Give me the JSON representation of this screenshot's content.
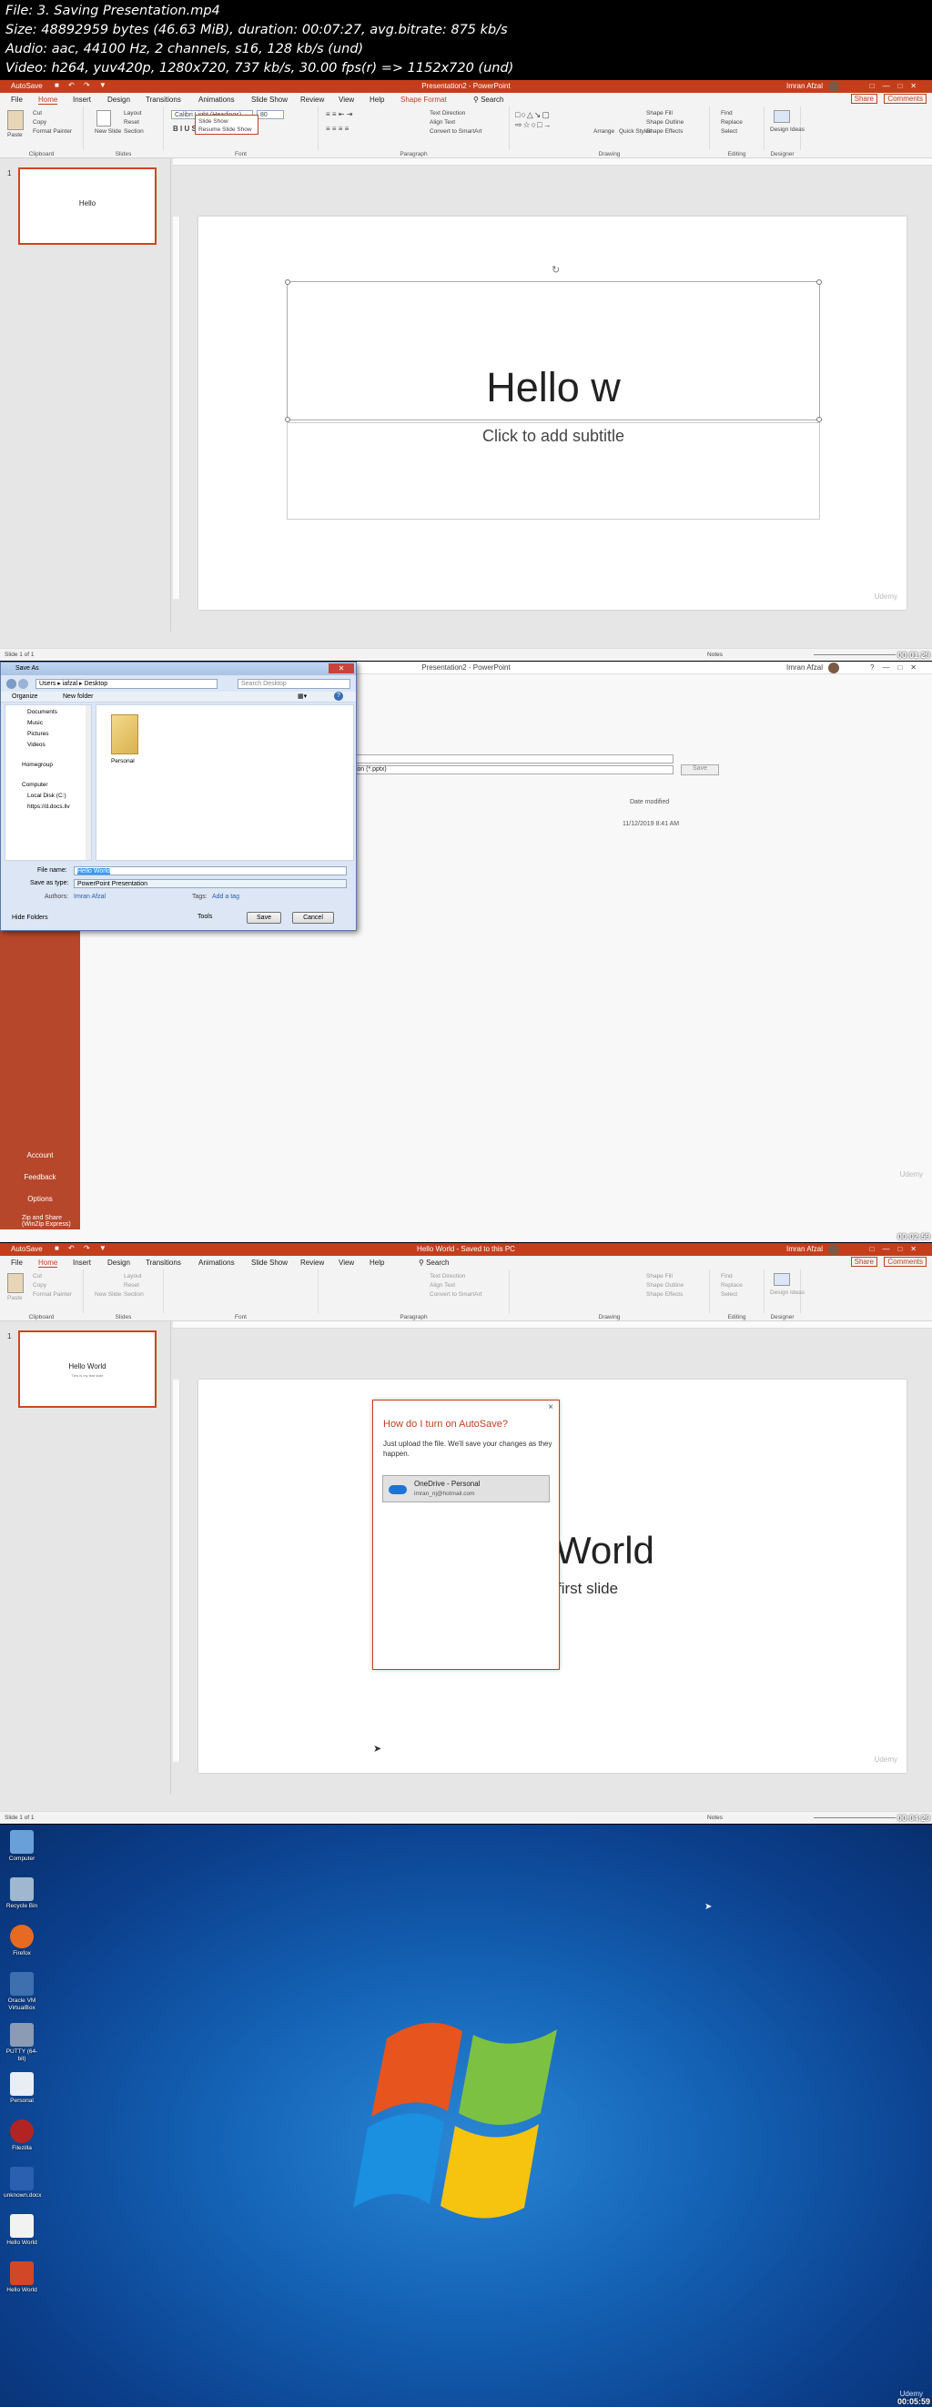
{
  "meta": {
    "file": "File: 3. Saving Presentation.mp4",
    "size": "Size: 48892959 bytes (46.63 MiB), duration: 00:07:27, avg.bitrate: 875 kb/s",
    "audio": "Audio: aac, 44100 Hz, 2 channels, s16, 128 kb/s (und)",
    "video": "Video: h264, yuv420p, 1280x720, 737 kb/s, 30.00 fps(r) => 1152x720 (und)"
  },
  "ppt": {
    "tabs": [
      "File",
      "Home",
      "Insert",
      "Design",
      "Transitions",
      "Animations",
      "Slide Show",
      "Review",
      "View",
      "Help",
      "Shape Format"
    ],
    "search": "Search",
    "share": "Share",
    "comments": "Comments",
    "user": "Imran Afzal",
    "autosave": "AutoSave",
    "ribbon_groups": [
      "Clipboard",
      "Slides",
      "Font",
      "Paragraph",
      "Drawing",
      "Editing",
      "Designer"
    ],
    "clipboard": {
      "paste": "Paste",
      "cut": "Cut",
      "copy": "Copy",
      "format_painter": "Format Painter"
    },
    "slides": {
      "new_slide": "New Slide",
      "layout": "Layout",
      "reset": "Reset",
      "section": "Section"
    },
    "paragraph": {
      "text_direction": "Text Direction",
      "align_text": "Align Text",
      "smartart": "Convert to SmartArt"
    },
    "drawing": {
      "arrange": "Arrange",
      "quick_styles": "Quick Styles",
      "shape_fill": "Shape Fill",
      "shape_outline": "Shape Outline",
      "shape_effects": "Shape Effects"
    },
    "editing": {
      "find": "Find",
      "replace": "Replace",
      "select": "Select"
    },
    "designer": {
      "design_ideas": "Design Ideas"
    },
    "notes": "Notes"
  },
  "frame1": {
    "title": "Presentation2 - PowerPoint",
    "font_name": "Calibri Light (Headings)",
    "font_size": "80",
    "dropdown": [
      "Slide Show",
      "Resume Slide Show"
    ],
    "slide_num": "1",
    "thumb_text": "Hello",
    "title_text": "Hello w",
    "subtitle_placeholder": "Click to add subtitle",
    "status": "Slide 1 of 1",
    "timestamp": "00:01:29"
  },
  "frame2": {
    "window_title": "Presentation2 - PowerPoint",
    "user": "Imran Afzal",
    "backstage": [
      "Account",
      "Feedback",
      "Options",
      "Zip and Share (WinZip Express)"
    ],
    "bg_filetype": "ation (*.pptx)",
    "bg_save": "Save",
    "bg_date_header": "Date modified",
    "bg_date": "11/12/2019 8:41 AM",
    "dialog_title": "Save As",
    "path": [
      "Users",
      "iafzal",
      "Desktop"
    ],
    "search_placeholder": "Search Desktop",
    "organize": "Organize",
    "new_folder": "New folder",
    "tree": [
      "Documents",
      "Music",
      "Pictures",
      "Videos",
      "Homegroup",
      "Computer",
      "Local Disk (C:)",
      "https://d.docs.liv"
    ],
    "folder": "Personal",
    "file_name_label": "File name:",
    "file_name": "Hello World",
    "type_label": "Save as type:",
    "type": "PowerPoint Presentation",
    "authors_label": "Authors:",
    "authors": "Imran Afzal",
    "tags_label": "Tags:",
    "tags": "Add a tag",
    "hide_folders": "Hide Folders",
    "tools": "Tools",
    "save": "Save",
    "cancel": "Cancel",
    "timestamp": "00:02:59"
  },
  "frame3": {
    "title": "Hello World - Saved to this PC",
    "thumb_text": "Hello World",
    "thumb_sub": "This is my first slide",
    "slide_title": "World",
    "slide_sub": "first slide",
    "popup_title": "How do I turn on AutoSave?",
    "popup_body": "Just upload the file. We'll save your changes as they happen.",
    "onedrive": "OneDrive - Personal",
    "email": "imran_nj@hotmail.com",
    "status": "Slide 1 of 1",
    "timestamp": "00:04:29"
  },
  "frame4": {
    "icons": [
      "Computer",
      "Recycle Bin",
      "Firefox",
      "Oracle VM VirtualBox",
      "PUTTY (64-bit)",
      "Personal",
      "Filezilla",
      "unknown.docx",
      "Hello World",
      "Hello World"
    ],
    "timestamp": "00:05:59"
  },
  "watermark": "Udemy"
}
